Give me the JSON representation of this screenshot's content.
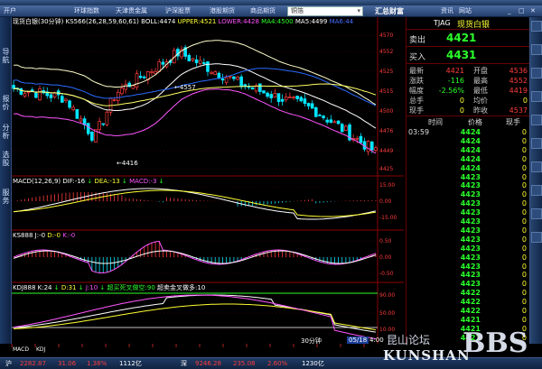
{
  "menu": {
    "label": "开户"
  },
  "toolbar": {
    "tabs": [
      "环球指数",
      "天津贵金属",
      "沪深股票",
      "港股期货",
      "商品期货"
    ],
    "search_value": "铜箔",
    "right_items": [
      "资讯",
      "网站"
    ],
    "brand": "汇总财富"
  },
  "sidebar": {
    "items": [
      "导航",
      "报价",
      "分析",
      "选股",
      "服务"
    ]
  },
  "main_chart": {
    "title": "现货白银(30分钟)",
    "ks": "KS566(26,28,59,60,61)",
    "boll": "BOLL:4474",
    "upper": "UPPER:4521",
    "lower": "LOWER:4428",
    "ma4": "MA4:4500",
    "ma5": "MA5:4499",
    "ma_extra": "MA6:44",
    "high_label": "4557",
    "low_label": "4416"
  },
  "price_axis": [
    "4570",
    "4552",
    "4525",
    "4515",
    "4500",
    "4476",
    "4449",
    "4425"
  ],
  "macd": {
    "name": "MACD(12,26,9)",
    "dif": "DIF:-16",
    "dea": "DEA:-13",
    "macd": "MACD:-3",
    "axis": [
      "15.00",
      "0.00",
      "-15.00"
    ]
  },
  "ks888": {
    "name": "KS888",
    "j": "J:-0",
    "d": "D:-0",
    "k": "K:-0",
    "axis": [
      "0.50",
      "0.00",
      "-0.50"
    ]
  },
  "kdj": {
    "name": "KDJ888",
    "k": "K:24",
    "d": "D:31",
    "j": "J:10",
    "buy": "超买死叉做空:90",
    "sell": "超卖金叉做多:10",
    "axis": [
      "90.00",
      "50.00",
      "10.00"
    ]
  },
  "time_axis": [
    "05/18",
    "4:00",
    "30分钟"
  ],
  "indicator_tabs": [
    "MACD",
    "KDJ"
  ],
  "quote": {
    "code": "TJAG",
    "name": "现货白银",
    "sell_label": "卖出",
    "sell": "4421",
    "buy_label": "买入",
    "buy": "4431",
    "rows": [
      {
        "l1": "最新",
        "v1": "4421",
        "l2": "开盘",
        "v2": "4536"
      },
      {
        "l1": "涨跌",
        "v1": "-116",
        "l2": "最高",
        "v2": "4552"
      },
      {
        "l1": "幅度",
        "v1": "-2.56%",
        "l2": "最低",
        "v2": "4419"
      },
      {
        "l1": "总手",
        "v1": "0",
        "l2": "均价",
        "v2": "0"
      },
      {
        "l1": "现手",
        "v1": "0",
        "l2": "昨收",
        "v2": "4537"
      }
    ],
    "tick_headers": [
      "时间",
      "价格",
      "现手"
    ],
    "ticks": [
      {
        "t": "03:59",
        "p": "4424",
        "v": "0"
      },
      {
        "t": "",
        "p": "4424",
        "v": "0"
      },
      {
        "t": "",
        "p": "4424",
        "v": "0"
      },
      {
        "t": "",
        "p": "4424",
        "v": "0"
      },
      {
        "t": "",
        "p": "4424",
        "v": "0"
      },
      {
        "t": "",
        "p": "4423",
        "v": "0"
      },
      {
        "t": "",
        "p": "4423",
        "v": "0"
      },
      {
        "t": "",
        "p": "4423",
        "v": "0"
      },
      {
        "t": "",
        "p": "4423",
        "v": "0"
      },
      {
        "t": "",
        "p": "4423",
        "v": "0"
      },
      {
        "t": "",
        "p": "4423",
        "v": "0"
      },
      {
        "t": "",
        "p": "4423",
        "v": "0"
      },
      {
        "t": "",
        "p": "4423",
        "v": "0"
      },
      {
        "t": "",
        "p": "4423",
        "v": "0"
      },
      {
        "t": "",
        "p": "4423",
        "v": "0"
      },
      {
        "t": "",
        "p": "4423",
        "v": "0"
      },
      {
        "t": "",
        "p": "4423",
        "v": "0"
      },
      {
        "t": "",
        "p": "4423",
        "v": "0"
      },
      {
        "t": "",
        "p": "4422",
        "v": "0"
      },
      {
        "t": "",
        "p": "4422",
        "v": "0"
      },
      {
        "t": "",
        "p": "4422",
        "v": "0"
      },
      {
        "t": "",
        "p": "4421",
        "v": "0"
      },
      {
        "t": "",
        "p": "4421",
        "v": "0"
      },
      {
        "t": "",
        "p": "4421",
        "v": "0"
      }
    ]
  },
  "status_bar": {
    "items": [
      "沪",
      "2282.87",
      "31.06",
      "1.38%",
      "1112亿",
      "深",
      "9246.28",
      "235.08",
      "2.60%",
      "1230亿"
    ]
  },
  "watermark": {
    "text": "昆山论坛",
    "latin": "KUNSHAN",
    "bbs": "BBS"
  },
  "colors": {
    "up": "#ff3c3c",
    "down": "#2aff2a",
    "bg": "#000000"
  }
}
